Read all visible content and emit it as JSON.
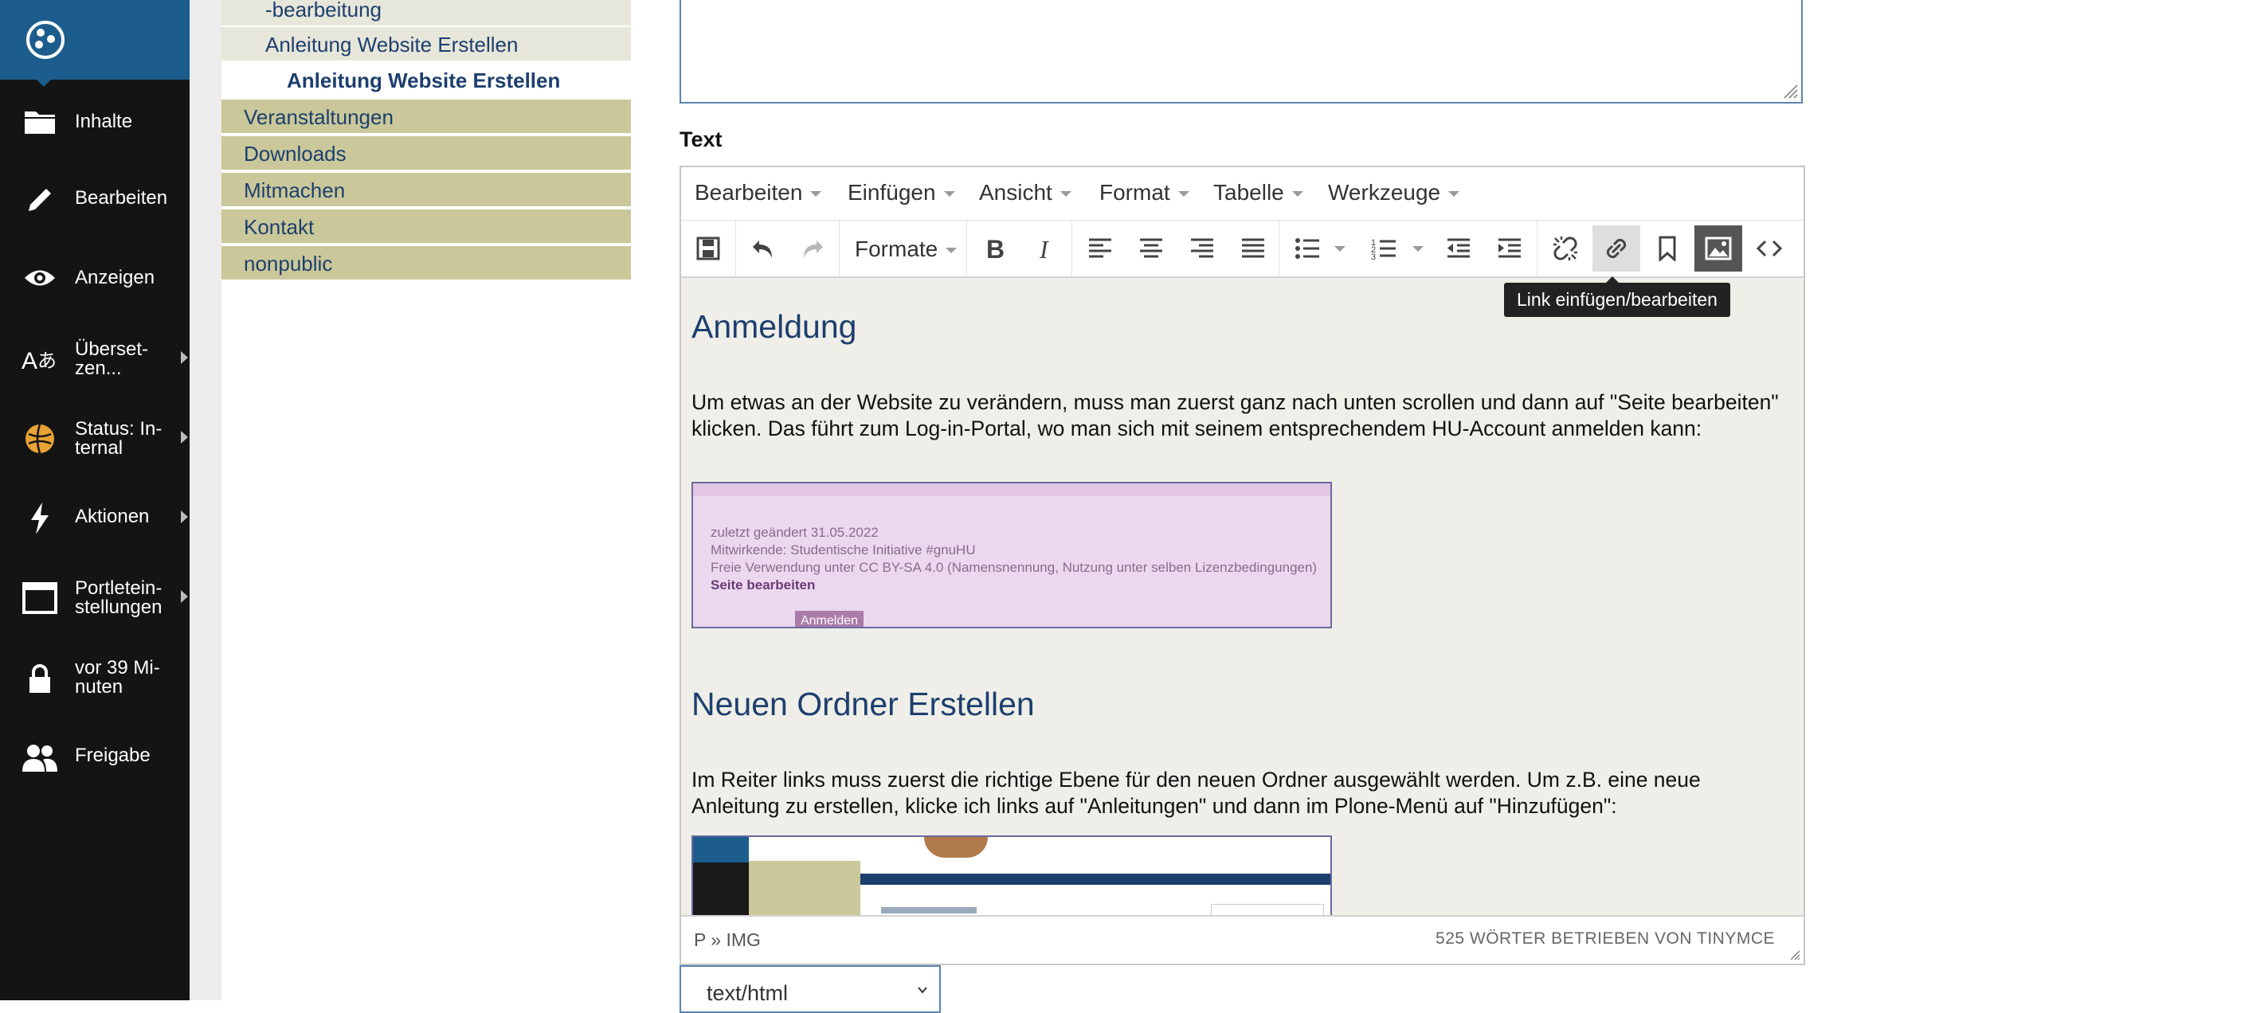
{
  "toolbar": {
    "items": [
      {
        "label": "Inhalte",
        "icon": "folder-icon"
      },
      {
        "label": "Bearbeiten",
        "icon": "pencil-icon"
      },
      {
        "label": "Anzeigen",
        "icon": "eye-icon"
      },
      {
        "label": "Überset-\nzen...",
        "icon": "translate-icon"
      },
      {
        "label": "Status: In-\nternal",
        "icon": "status-icon"
      },
      {
        "label": "Aktionen",
        "icon": "lightning-icon"
      },
      {
        "label": "Portletein-\nstellungen",
        "icon": "portlet-icon"
      },
      {
        "label": "vor 39 Mi-\nnuten",
        "icon": "lock-icon"
      },
      {
        "label": "Freigabe",
        "icon": "users-icon"
      }
    ]
  },
  "navigation": {
    "items": [
      {
        "label": "-bearbeitung"
      },
      {
        "label": "Anleitung Website Erstellen"
      },
      {
        "label": "Anleitung Website Erstellen"
      },
      {
        "label": "Veranstaltungen"
      },
      {
        "label": "Downloads"
      },
      {
        "label": "Mitmachen"
      },
      {
        "label": "Kontakt"
      },
      {
        "label": "nonpublic"
      }
    ]
  },
  "form": {
    "text_label": "Text",
    "format_select": "text/html"
  },
  "editor": {
    "menus": [
      "Bearbeiten",
      "Einfügen",
      "Ansicht",
      "Format",
      "Tabelle",
      "Werkzeuge"
    ],
    "formats_label": "Formate",
    "tooltip": "Link einfügen/bearbeiten",
    "path": "P » IMG",
    "wordcount": "525 WÖRTER BETRIEBEN VON TINYMCE",
    "content": {
      "heading1": "Anmeldung",
      "para1": "Um etwas an der Website zu verändern, muss man zuerst ganz nach unten scrollen und dann auf \"Seite bearbeiten\" klicken. Das führt zum Log-in-Portal, wo man sich mit seinem entsprechendem HU-Account anmelden kann:",
      "image1": {
        "line1": "zuletzt geändert 31.05.2022",
        "line2": "Mitwirkende: Studentische Initiative #gnuHU",
        "line3": "Freie Verwendung unter CC BY-SA 4.0 (Namensnennung, Nutzung unter selben Lizenzbedingungen)",
        "line4": "Seite bearbeiten",
        "button": "Anmelden"
      },
      "heading2": "Neuen Ordner Erstellen",
      "para2": "Im Reiter links muss zuerst die richtige Ebene für den neuen Ordner ausgewählt werden. Um z.B. eine neue Anleitung zu erstellen, klicke ich links auf \"Anleitungen\" und dann im Plone-Menü auf \"Hinzufügen\":"
    }
  },
  "colors": {
    "toolbar_bg": "#141414",
    "logo_bg": "#1c5d8e",
    "nav_top": "#cac89a",
    "nav_sub": "#e6e6da",
    "link_blue": "#1d3f6e",
    "editor_bg": "#efeee8"
  }
}
